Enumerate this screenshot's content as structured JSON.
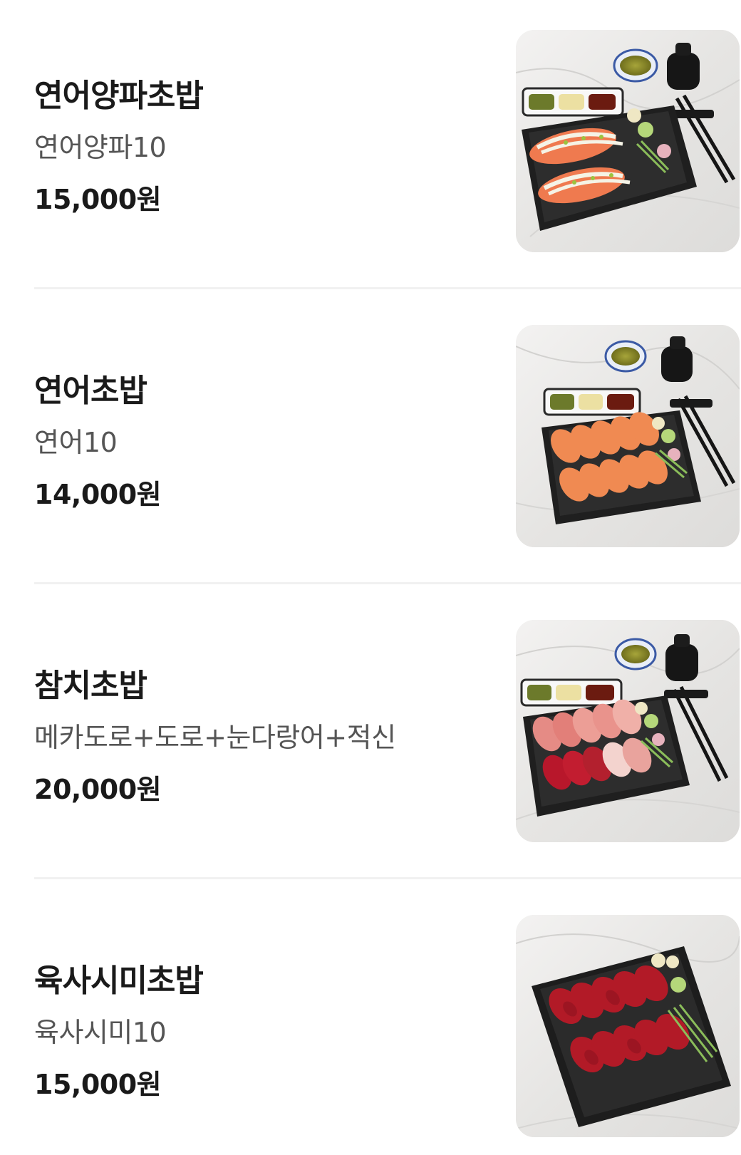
{
  "menu": {
    "items": [
      {
        "name": "연어양파초밥",
        "description": "연어양파10",
        "price": "15,000원",
        "photo": "salmon-onion-sushi-platter-photo"
      },
      {
        "name": "연어초밥",
        "description": "연어10",
        "price": "14,000원",
        "photo": "salmon-sushi-platter-photo"
      },
      {
        "name": "참치초밥",
        "description": "메카도로+도로+눈다랑어+적신",
        "price": "20,000원",
        "photo": "tuna-sushi-platter-photo"
      },
      {
        "name": "육사시미초밥",
        "description": "육사시미10",
        "price": "15,000원",
        "photo": "beef-sashimi-sushi-platter-photo"
      }
    ]
  },
  "colors": {
    "title": "#1a1a1a",
    "description": "#555555",
    "divider": "#f1f1f1",
    "background": "#ffffff"
  }
}
